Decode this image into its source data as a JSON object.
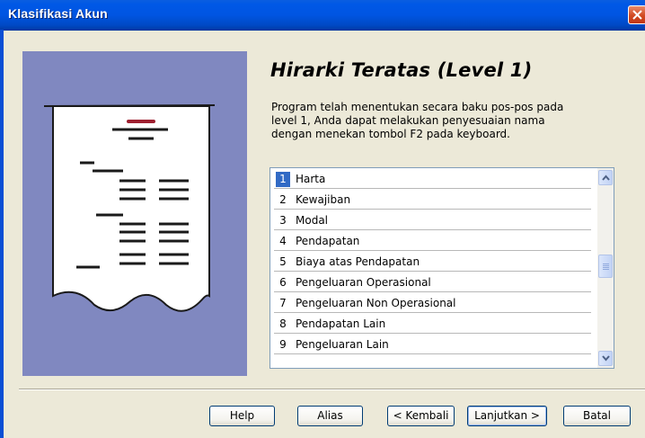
{
  "window": {
    "title": "Klasifikasi Akun"
  },
  "page": {
    "heading": "Hirarki Teratas (Level 1)",
    "description": "Program telah menentukan secara baku pos-pos pada level 1, Anda dapat melakukan penyesuaian nama dengan menekan tombol F2 pada keyboard."
  },
  "list": {
    "items": [
      {
        "num": "1",
        "label": "Harta",
        "selected": true
      },
      {
        "num": "2",
        "label": "Kewajiban"
      },
      {
        "num": "3",
        "label": "Modal"
      },
      {
        "num": "4",
        "label": "Pendapatan"
      },
      {
        "num": "5",
        "label": "Biaya atas Pendapatan"
      },
      {
        "num": "6",
        "label": "Pengeluaran Operasional"
      },
      {
        "num": "7",
        "label": "Pengeluaran Non Operasional"
      },
      {
        "num": "8",
        "label": "Pendapatan Lain"
      },
      {
        "num": "9",
        "label": "Pengeluaran Lain"
      }
    ]
  },
  "buttons": {
    "help": "Help",
    "alias": "Alias",
    "back": "< Kembali",
    "next": "Lanjutkan >",
    "cancel": "Batal"
  },
  "colors": {
    "titlebar": "#0055e2",
    "illustration_bg": "#8088c0",
    "selection": "#316ac5",
    "dialog_bg": "#ece9d8"
  }
}
